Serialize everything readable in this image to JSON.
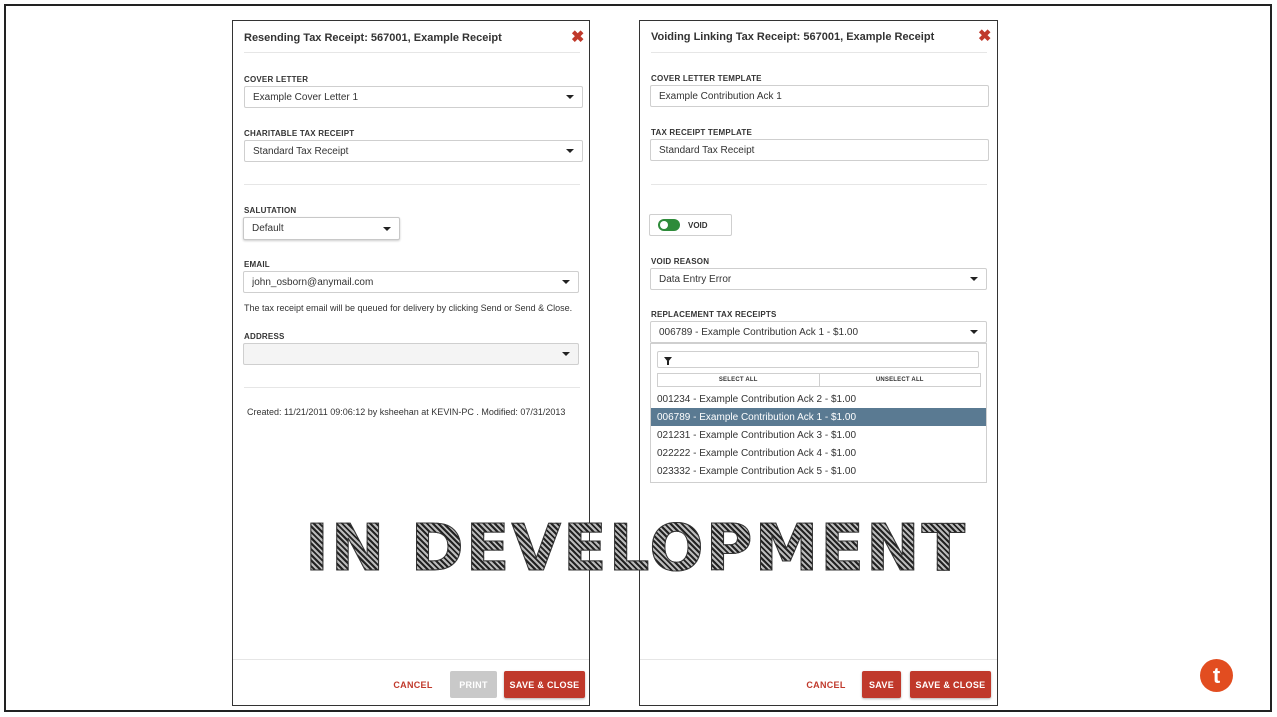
{
  "left_panel": {
    "title": "Resending Tax Receipt: 567001, Example Receipt",
    "close_symbol": "✖",
    "cover_letter": {
      "label": "COVER LETTER",
      "value": "Example Cover Letter 1"
    },
    "charitable_tax_receipt": {
      "label": "CHARITABLE TAX RECEIPT",
      "value": "Standard Tax Receipt"
    },
    "salutation": {
      "label": "SALUTATION",
      "value": "Default"
    },
    "email": {
      "label": "EMAIL",
      "value": "john_osborn@anymail.com"
    },
    "email_note": "The tax receipt email will be queued for delivery by clicking Send or Send & Close.",
    "address": {
      "label": "ADDRESS",
      "value": ""
    },
    "created_info": "Created: 11/21/2011 09:06:12 by ksheehan at KEVIN-PC . Modified: 07/31/2013",
    "buttons": {
      "cancel": "CANCEL",
      "print": "PRINT",
      "save_close": "SAVE & CLOSE"
    }
  },
  "right_panel": {
    "title": "Voiding Linking Tax Receipt: 567001, Example Receipt",
    "close_symbol": "✖",
    "cover_letter_template": {
      "label": "COVER LETTER TEMPLATE",
      "value": "Example Contribution Ack 1"
    },
    "tax_receipt_template": {
      "label": "TAX RECEIPT TEMPLATE",
      "value": "Standard Tax Receipt"
    },
    "void_toggle": {
      "label": "VOID",
      "on": true
    },
    "void_reason": {
      "label": "VOID REASON",
      "value": "Data Entry Error"
    },
    "replacement": {
      "label": "REPLACEMENT TAX RECEIPTS",
      "value": "006789 - Example Contribution Ack 1 - $1.00",
      "filter_value": "",
      "select_all": "SELECT ALL",
      "unselect_all": "UNSELECT ALL",
      "options": [
        {
          "text": "001234 - Example Contribution Ack 2 - $1.00",
          "selected": false
        },
        {
          "text": "006789 - Example Contribution Ack 1 - $1.00",
          "selected": true
        },
        {
          "text": "021231 - Example Contribution Ack 3 - $1.00",
          "selected": false
        },
        {
          "text": "022222 - Example Contribution Ack 4 - $1.00",
          "selected": false
        },
        {
          "text": "023332 - Example Contribution Ack 5 - $1.00",
          "selected": false
        }
      ]
    },
    "buttons": {
      "cancel": "CANCEL",
      "save": "SAVE",
      "save_close": "SAVE & CLOSE"
    }
  },
  "watermark": "IN DEVELOPMENT",
  "logo_letter": "t",
  "colors": {
    "accent_red": "#c0392b",
    "selected_row": "#5a7a92",
    "toggle_on": "#2e8b3a",
    "logo_orange": "#e24d20"
  },
  "icons": {
    "close": "close-icon",
    "caret": "chevron-down-icon",
    "filter": "filter-icon"
  }
}
